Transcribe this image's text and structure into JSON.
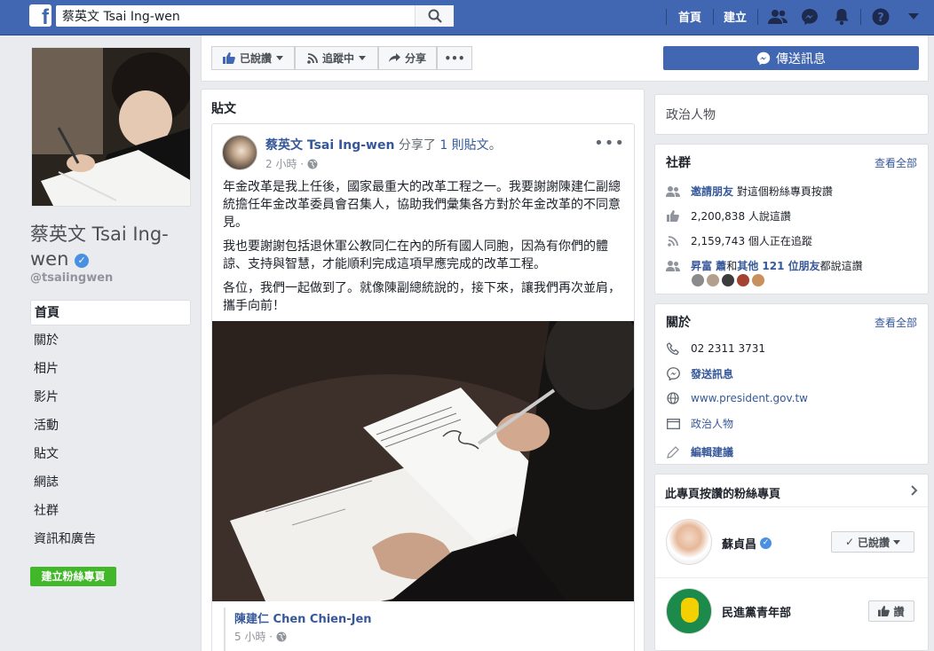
{
  "topbar": {
    "logo": "f",
    "search_value": "蔡英文 Tsai Ing-wen",
    "home_label": "首頁",
    "create_label": "建立"
  },
  "left": {
    "page_name": "蔡英文 Tsai Ing-wen",
    "handle": "@tsaiingwen",
    "nav": [
      "首頁",
      "關於",
      "相片",
      "影片",
      "活動",
      "貼文",
      "網誌",
      "社群",
      "資訊和廣告"
    ],
    "create_page": "建立粉絲專頁"
  },
  "actions": {
    "liked": "已說讚",
    "following": "追蹤中",
    "share": "分享",
    "more": "•••",
    "send_message": "傳送訊息"
  },
  "posts": {
    "title": "貼文",
    "post": {
      "author": "蔡英文 Tsai Ing-wen",
      "action": " 分享了 ",
      "link": "1 則貼文",
      "tail": "。",
      "time": "2 小時 ·",
      "paragraphs": [
        "年金改革是我上任後，國家最重大的改革工程之一。我要謝謝陳建仁副總統擔任年金改革委員會召集人，協助我們彙集各方對於年金改革的不同意見。",
        "我也要謝謝包括退休軍公教同仁在內的所有國人同胞，因為有你們的體諒、支持與智慧，才能順利完成這項早應完成的改革工程。",
        "各位，我們一起做到了。就像陳副總統說的，接下來，讓我們再次並肩，攜手向前！"
      ],
      "shared_author": "陳建仁 Chen Chien-Jen",
      "shared_time": "5 小時 ·"
    }
  },
  "right": {
    "category": "政治人物",
    "community": {
      "title": "社群",
      "see_all": "查看全部",
      "invite_link": "邀請朋友",
      "invite_text": "對這個粉絲專頁按讚",
      "likes": "2,200,838 人說這讚",
      "followers": "2,159,743 個人正在追蹤",
      "friends_a": "昇富 蕭",
      "friends_mid": "和",
      "friends_b": "其他 121 位朋友",
      "friends_tail": "都說這讚"
    },
    "about": {
      "title": "關於",
      "see_all": "查看全部",
      "phone": "02 2311 3731",
      "message": "發送訊息",
      "website": "www.president.gov.tw",
      "category": "政治人物",
      "edit": "編輯建議"
    },
    "liked_pages": {
      "title": "此專頁按讚的粉絲專頁",
      "items": [
        {
          "name": "蘇貞昌",
          "button": "已說讚"
        },
        {
          "name": "民進黨青年部",
          "button": "讚"
        }
      ]
    }
  },
  "colors": {
    "brand": "#4267b2",
    "link": "#365899",
    "green": "#42b72a",
    "verify": "#4a90e2"
  }
}
